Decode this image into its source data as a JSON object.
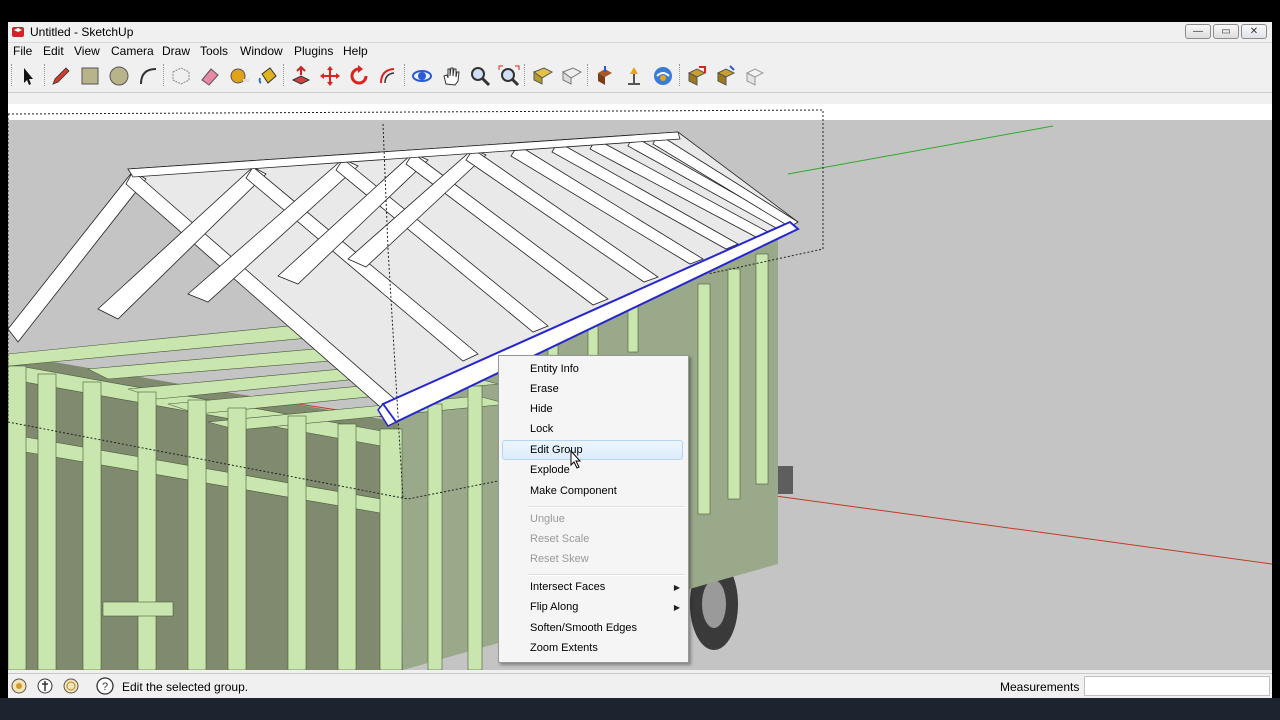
{
  "window": {
    "title": "Untitled - SketchUp"
  },
  "menubar": {
    "items": [
      "File",
      "Edit",
      "View",
      "Camera",
      "Draw",
      "Tools",
      "Window",
      "Plugins",
      "Help"
    ]
  },
  "toolbar": {
    "tools": [
      "select-icon",
      "pencil-icon",
      "rectangle-icon",
      "circle-icon",
      "arc-icon",
      "make-component-icon",
      "eraser-icon",
      "tape-measure-icon",
      "paint-bucket-icon",
      "push-pull-icon",
      "move-icon",
      "rotate-icon",
      "offset-icon",
      "orbit-icon",
      "pan-icon",
      "zoom-icon",
      "zoom-extents-icon",
      "add-location-icon",
      "google-earth-icon",
      "get-models-icon",
      "share-model-icon",
      "share-component-icon",
      "photo-textures-icon",
      "get-components-icon",
      "share-components-icon",
      "extension-icon"
    ]
  },
  "context_menu": {
    "items": [
      {
        "label": "Entity Info",
        "enabled": true
      },
      {
        "label": "Erase",
        "enabled": true
      },
      {
        "label": "Hide",
        "enabled": true
      },
      {
        "label": "Lock",
        "enabled": true
      },
      {
        "label": "Edit Group",
        "enabled": true,
        "highlighted": true
      },
      {
        "label": "Explode",
        "enabled": true
      },
      {
        "label": "Make Component",
        "enabled": true
      },
      {
        "label": "Unglue",
        "enabled": false
      },
      {
        "label": "Reset Scale",
        "enabled": false
      },
      {
        "label": "Reset Skew",
        "enabled": false
      },
      {
        "label": "Intersect Faces",
        "enabled": true,
        "submenu": true
      },
      {
        "label": "Flip Along",
        "enabled": true,
        "submenu": true
      },
      {
        "label": "Soften/Smooth Edges",
        "enabled": true
      },
      {
        "label": "Zoom Extents",
        "enabled": true
      }
    ]
  },
  "statusbar": {
    "message": "Edit the selected group.",
    "measurements_label": "Measurements",
    "measurements_value": ""
  },
  "colors": {
    "framing": "#c8e6ae",
    "selection": "#2626d0",
    "rafters": "#ffffff",
    "sky": "#ffffff",
    "ground": "#c8c8c8"
  }
}
